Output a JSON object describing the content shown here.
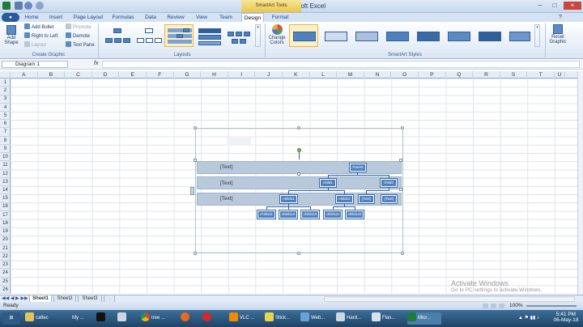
{
  "window": {
    "title": "Book1 - Microsoft Excel",
    "context_tab": "SmartArt Tools"
  },
  "tabs": [
    "Home",
    "Insert",
    "Page Layout",
    "Formulas",
    "Data",
    "Review",
    "View",
    "Team",
    "Design",
    "Format"
  ],
  "active_tab": "Design",
  "ribbon": {
    "create_graphic": {
      "add_shape": "Add Shape",
      "add_bullet": "Add Bullet",
      "right_to_left": "Right to Left",
      "layout": "Layout",
      "promote": "Promote",
      "demote": "Demote",
      "text_pane": "Text Pane",
      "label": "Create Graphic"
    },
    "layouts_label": "Layouts",
    "change_colors": "Change Colors",
    "styles_label": "SmartArt Styles",
    "reset_graphic": "Reset Graphic"
  },
  "formula_bar": {
    "name_box": "Diagram 1",
    "fx": "fx",
    "value": ""
  },
  "columns": [
    "A",
    "B",
    "C",
    "D",
    "E",
    "F",
    "G",
    "H",
    "I",
    "J",
    "K",
    "L",
    "M",
    "N",
    "O",
    "P",
    "Q",
    "R",
    "S",
    "T",
    "U"
  ],
  "rows": [
    "1",
    "2",
    "3",
    "4",
    "5",
    "6",
    "7",
    "8",
    "9",
    "10",
    "11",
    "12",
    "13",
    "14",
    "15",
    "16",
    "17",
    "18",
    "19",
    "20",
    "21",
    "22",
    "23",
    "24",
    "25",
    "26"
  ],
  "diagram": {
    "level_labels": [
      "[Text]",
      "[Text]",
      "[Text]"
    ],
    "parent": "Parent",
    "level2": [
      "child1",
      "child2"
    ],
    "level3": [
      "child11",
      "child12",
      "[Text]",
      "[Text]"
    ],
    "level4": [
      "child111",
      "child112",
      "child113",
      "child121",
      "child122"
    ]
  },
  "sheets": [
    "Sheet1",
    "Sheet2",
    "Sheet3"
  ],
  "status": {
    "ready": "Ready",
    "zoom": "100%"
  },
  "watermark": {
    "line1": "Activate Windows",
    "line2": "Go to PC settings to activate Windows."
  },
  "taskbar": {
    "items": [
      "caltec",
      "My ...",
      "",
      "",
      "tree ...",
      "",
      "",
      "VLC ...",
      "Stick...",
      "Web...",
      "Hard...",
      "Flas...",
      "Micr..."
    ],
    "time": "5:41 PM",
    "date": "06-May-18"
  },
  "colors": {
    "accent": "#4f81bd",
    "ribbon": "#dbe6f4",
    "taskbar": "#1f4466"
  }
}
